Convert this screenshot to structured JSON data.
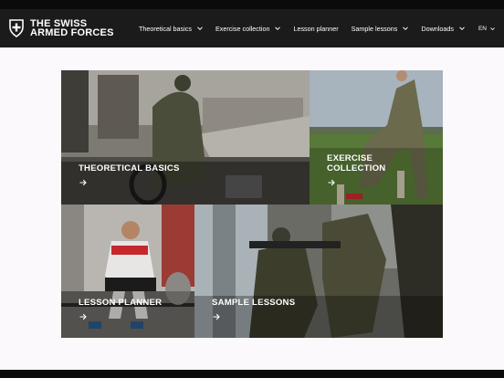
{
  "brand": {
    "line1": "THE SWISS",
    "line2": "ARMED FORCES"
  },
  "nav": {
    "items": [
      {
        "label": "Theoretical basics"
      },
      {
        "label": "Exercise collection"
      },
      {
        "label": "Lesson planner"
      },
      {
        "label": "Sample lessons"
      },
      {
        "label": "Downloads"
      }
    ],
    "language": "EN"
  },
  "tiles": [
    {
      "line1": "THEORETICAL BASICS",
      "line2": ""
    },
    {
      "line1": "EXERCISE",
      "line2": "COLLECTION"
    },
    {
      "line1": "LESSON PLANNER",
      "line2": ""
    },
    {
      "line1": "SAMPLE LESSONS",
      "line2": ""
    }
  ],
  "colors": {
    "topbar": "#1b1b1b",
    "page": "#fbf9fb",
    "text_on_dark": "#ffffff",
    "accent_red": "#c4282d"
  }
}
